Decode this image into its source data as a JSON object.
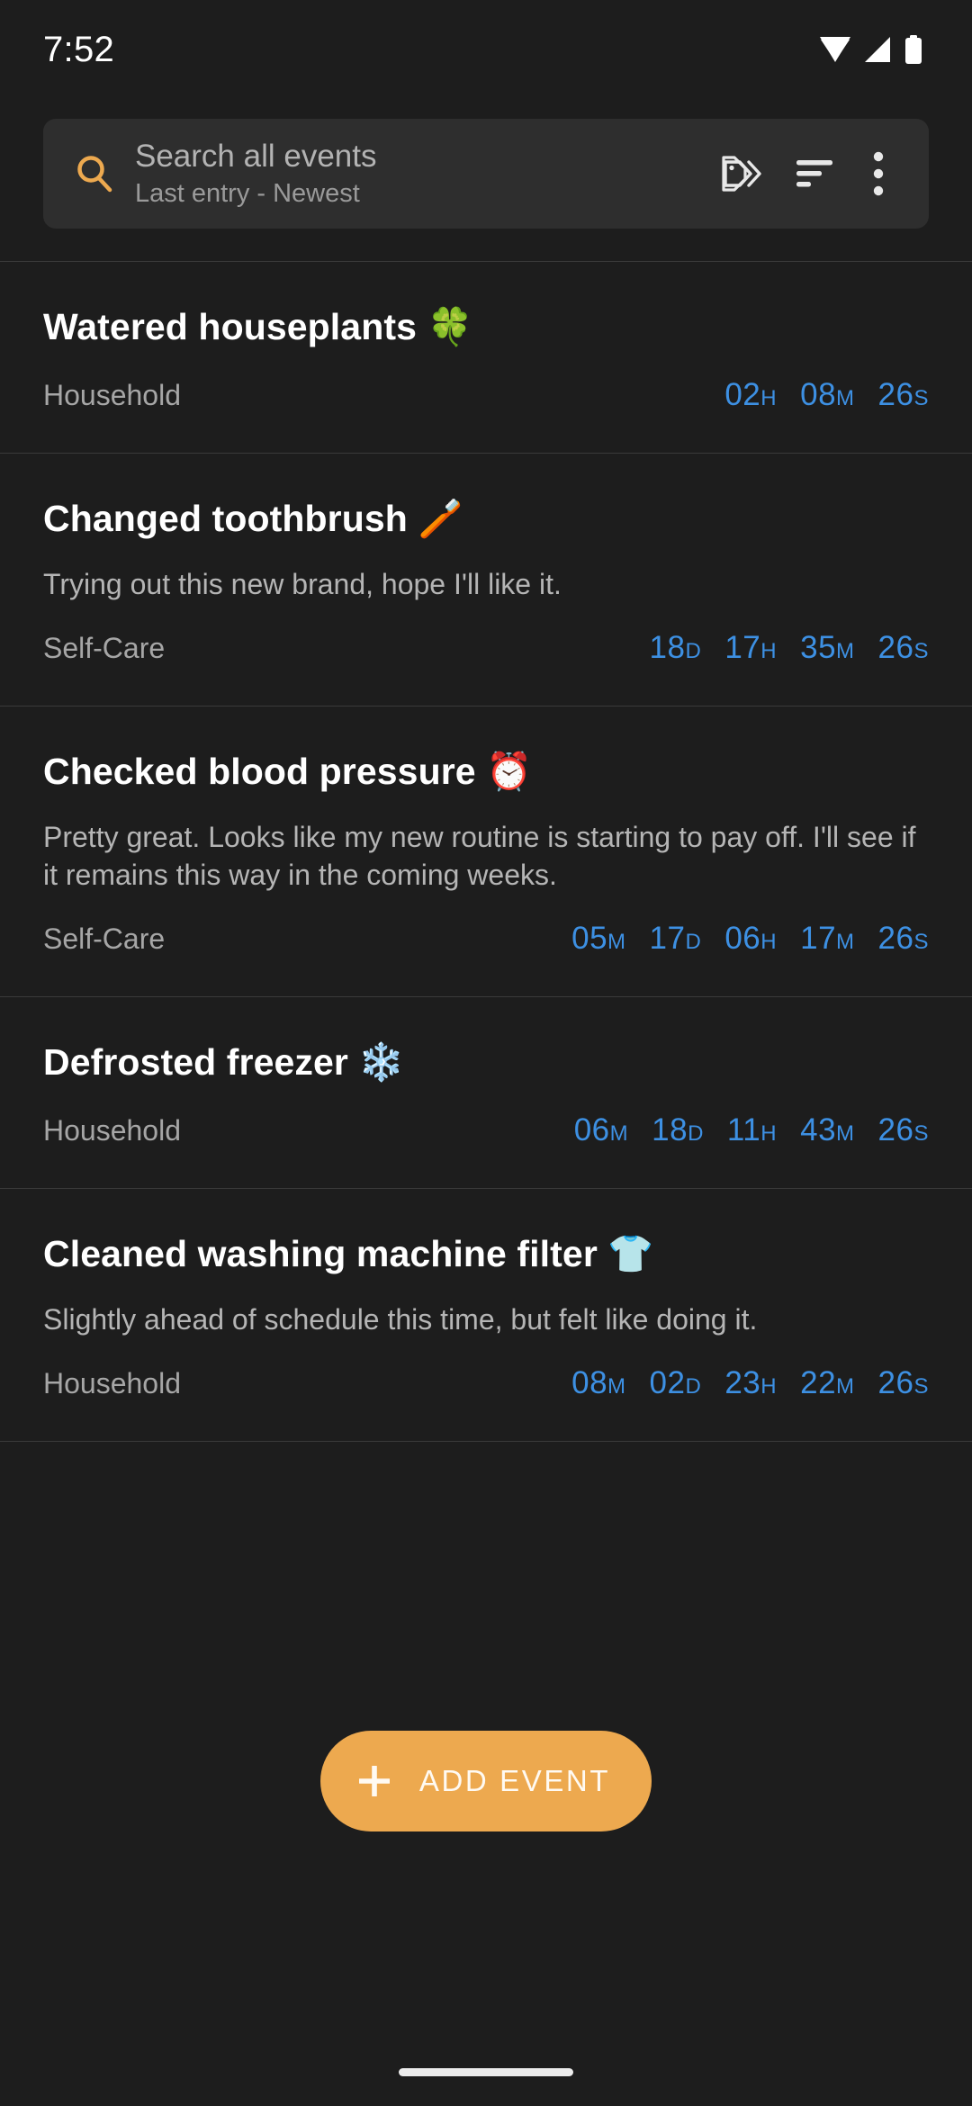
{
  "status_bar": {
    "time": "7:52",
    "icons": [
      "wifi-icon",
      "cellular-signal-icon",
      "battery-icon"
    ]
  },
  "search": {
    "icon": "search-icon",
    "placeholder": "Search all events",
    "sort_summary": "Last entry - Newest",
    "actions": [
      {
        "name": "tags-icon",
        "label": "Tags"
      },
      {
        "name": "sort-icon",
        "label": "Sort"
      },
      {
        "name": "overflow-menu-icon",
        "label": "More options"
      }
    ]
  },
  "events": [
    {
      "title": "Watered houseplants 🍀",
      "note": "",
      "category": "Household",
      "time": [
        {
          "value": "02",
          "unit": "H"
        },
        {
          "value": "08",
          "unit": "M"
        },
        {
          "value": "26",
          "unit": "S"
        }
      ]
    },
    {
      "title": "Changed toothbrush 🪥",
      "note": "Trying out this new brand, hope I'll like it.",
      "category": "Self-Care",
      "time": [
        {
          "value": "18",
          "unit": "D"
        },
        {
          "value": "17",
          "unit": "H"
        },
        {
          "value": "35",
          "unit": "M"
        },
        {
          "value": "26",
          "unit": "S"
        }
      ]
    },
    {
      "title": "Checked blood pressure ⏰",
      "note": "Pretty great. Looks like my new routine is starting to pay off. I'll see if it remains this way in the coming weeks.",
      "category": "Self-Care",
      "time": [
        {
          "value": "05",
          "unit": "M"
        },
        {
          "value": "17",
          "unit": "D"
        },
        {
          "value": "06",
          "unit": "H"
        },
        {
          "value": "17",
          "unit": "M"
        },
        {
          "value": "26",
          "unit": "S"
        }
      ]
    },
    {
      "title": "Defrosted freezer ❄️",
      "note": "",
      "category": "Household",
      "time": [
        {
          "value": "06",
          "unit": "M"
        },
        {
          "value": "18",
          "unit": "D"
        },
        {
          "value": "11",
          "unit": "H"
        },
        {
          "value": "43",
          "unit": "M"
        },
        {
          "value": "26",
          "unit": "S"
        }
      ]
    },
    {
      "title": "Cleaned washing machine filter 👕",
      "note": "Slightly ahead of schedule this time, but felt like doing it.",
      "category": "Household",
      "time": [
        {
          "value": "08",
          "unit": "M"
        },
        {
          "value": "02",
          "unit": "D"
        },
        {
          "value": "23",
          "unit": "H"
        },
        {
          "value": "22",
          "unit": "M"
        },
        {
          "value": "26",
          "unit": "S"
        }
      ]
    }
  ],
  "fab": {
    "icon": "plus-icon",
    "label": "ADD EVENT"
  },
  "colors": {
    "background": "#1d1d1d",
    "search_bar": "#2e2e2e",
    "accent": "#eda94f",
    "time_blue": "#3d90e3",
    "title": "#ffffff",
    "secondary_text": "#a6a6a6",
    "divider": "#3a3a3a"
  }
}
